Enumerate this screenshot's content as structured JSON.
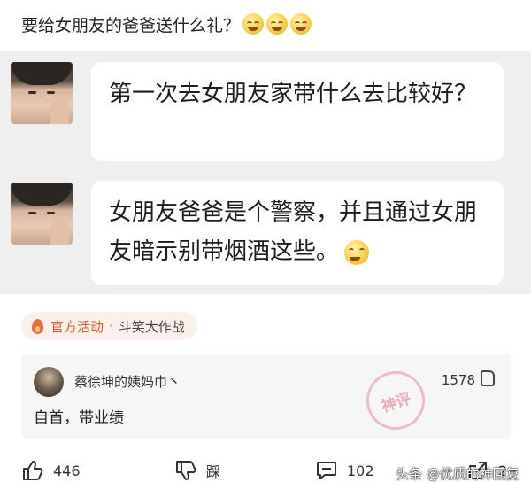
{
  "post": {
    "title": "要给女朋友的爸爸送什么礼？"
  },
  "chat": [
    {
      "text": "第一次去女朋友家带什么去比较好？"
    },
    {
      "text": "女朋友爸爸是个警察，并且通过女朋友暗示别带烟酒这些。"
    }
  ],
  "activity": {
    "tag": "官方活动",
    "separator": "·",
    "name": "斗笑大作战"
  },
  "comment": {
    "user": "蔡徐坤的姨妈巾丶",
    "likes": "1578",
    "text": "自首，带业绩",
    "stamp": "神评"
  },
  "actions": {
    "like_count": "446",
    "dislike_label": "踩",
    "comment_count": "102",
    "share_count": "2"
  },
  "watermark": "头条 @优质的神回复",
  "colors": {
    "accent": "#e85a2a",
    "chat_bg": "#efefef",
    "card_bg": "#f6f6f6"
  }
}
